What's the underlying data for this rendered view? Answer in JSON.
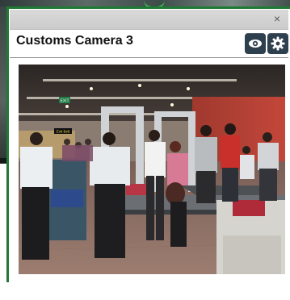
{
  "window": {
    "close_glyph": "×"
  },
  "camera": {
    "title": "Customs Camera 3"
  },
  "toolbar": {
    "view_icon": "eye-icon",
    "settings_icon": "gear-icon"
  },
  "feed": {
    "signs": [
      "EXIT",
      "Exit Belt"
    ],
    "scene": "airport customs security checkpoint"
  },
  "colors": {
    "frame_accent": "#1f7a34",
    "button_bg": "#2e3f4e",
    "titlebar_bg": "#d3d3d3"
  }
}
